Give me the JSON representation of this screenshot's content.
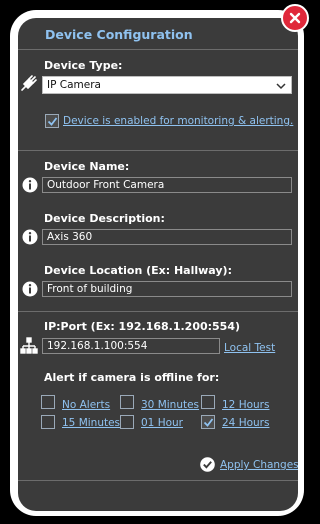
{
  "dialog": {
    "title": "Device Configuration"
  },
  "device_type": {
    "label": "Device Type:",
    "selected": "IP Camera",
    "enabled_checked": true,
    "enabled_label": "Device is enabled for monitoring & alerting."
  },
  "device_name": {
    "label": "Device Name:",
    "value": "Outdoor Front Camera"
  },
  "device_description": {
    "label": "Device Description:",
    "value": "Axis 360"
  },
  "device_location": {
    "label": "Device Location (Ex: Hallway):",
    "value": "Front of building"
  },
  "ip_port": {
    "label": "IP:Port (Ex: 192.168.1.200:554)",
    "value": "192.168.1.100:554",
    "local_test": "Local Test"
  },
  "offline_alert": {
    "label": "Alert if camera is offline for:",
    "options": [
      {
        "label": "No Alerts",
        "checked": false
      },
      {
        "label": "30 Minutes",
        "checked": false
      },
      {
        "label": "12 Hours",
        "checked": false
      },
      {
        "label": "15 Minutes",
        "checked": false
      },
      {
        "label": "01 Hour",
        "checked": false
      },
      {
        "label": "24 Hours",
        "checked": true
      }
    ]
  },
  "footer": {
    "apply_label": "Apply Changes"
  },
  "colors": {
    "panel_bg": "#3b3b3b",
    "accent_link": "#8fc2f0",
    "close_red": "#e0283a"
  },
  "icons": [
    "close-icon",
    "plug-icon",
    "chevron-down-icon",
    "info-icon",
    "network-icon",
    "checkmark-icon",
    "check-circle-icon"
  ]
}
